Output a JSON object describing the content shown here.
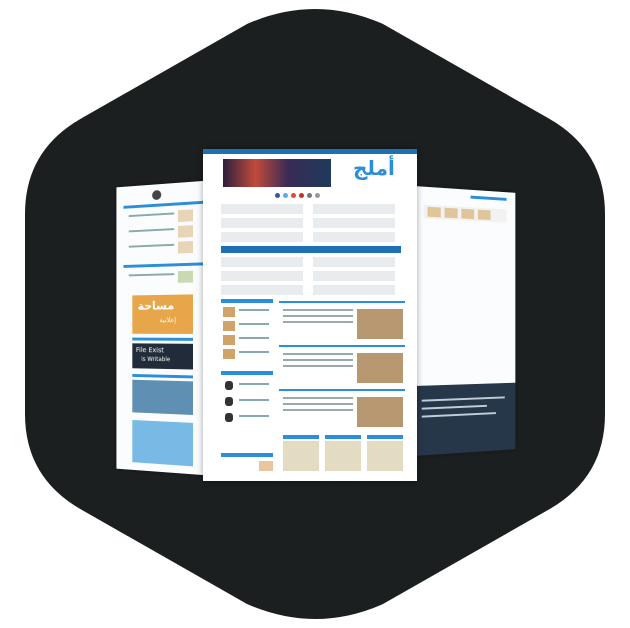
{
  "site": {
    "logo_text": "أملج",
    "logo_color": "#2a8fd8",
    "brand_blue": "#1f6fb4",
    "hex_color": "#1b1f20"
  },
  "side_banners": {
    "space_ad": "مساحة",
    "space_ad_sub": "إعلانية",
    "file_exist": "File Exist",
    "is_writable": "is Writable"
  }
}
